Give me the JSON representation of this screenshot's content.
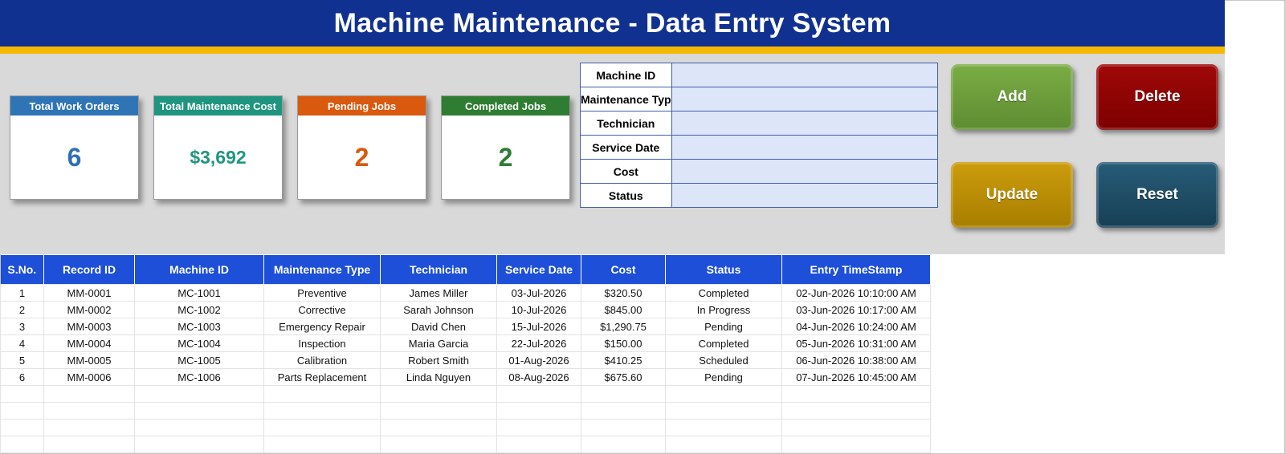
{
  "title": "Machine Maintenance - Data Entry System",
  "colors": {
    "title_bg": "#10318f",
    "stripe": "#f5b800",
    "header_bg": "#1d4fd8"
  },
  "kpis": [
    {
      "label": "Total Work Orders",
      "value": "6",
      "head_color": "#2f75b6",
      "value_color": "#2e6fb6"
    },
    {
      "label": "Total Maintenance Cost",
      "value": "$3,692",
      "head_color": "#1f9580",
      "value_color": "#1f9580"
    },
    {
      "label": "Pending Jobs",
      "value": "2",
      "head_color": "#d9590e",
      "value_color": "#d9590e"
    },
    {
      "label": "Completed Jobs",
      "value": "2",
      "head_color": "#2e7d32",
      "value_color": "#2e7d32"
    }
  ],
  "form": {
    "machine_id": {
      "label": "Machine ID",
      "value": ""
    },
    "maintenance_type": {
      "label": "Maintenance Typ",
      "value": ""
    },
    "technician": {
      "label": "Technician",
      "value": ""
    },
    "service_date": {
      "label": "Service Date",
      "value": ""
    },
    "cost": {
      "label": "Cost",
      "value": ""
    },
    "status": {
      "label": "Status",
      "value": ""
    }
  },
  "buttons": {
    "add": {
      "label": "Add",
      "color": "#6a9a3a"
    },
    "delete": {
      "label": "Delete",
      "color": "#8f0000"
    },
    "update": {
      "label": "Update",
      "color": "#bf9000"
    },
    "reset": {
      "label": "Reset",
      "color": "#1f4e68"
    }
  },
  "table": {
    "columns": [
      "S.No.",
      "Record ID",
      "Machine ID",
      "Maintenance Type",
      "Technician",
      "Service Date",
      "Cost",
      "Status",
      "Entry TimeStamp"
    ],
    "rows": [
      [
        "1",
        "MM-0001",
        "MC-1001",
        "Preventive",
        "James Miller",
        "03-Jul-2026",
        "$320.50",
        "Completed",
        "02-Jun-2026 10:10:00 AM"
      ],
      [
        "2",
        "MM-0002",
        "MC-1002",
        "Corrective",
        "Sarah Johnson",
        "10-Jul-2026",
        "$845.00",
        "In Progress",
        "03-Jun-2026 10:17:00 AM"
      ],
      [
        "3",
        "MM-0003",
        "MC-1003",
        "Emergency Repair",
        "David Chen",
        "15-Jul-2026",
        "$1,290.75",
        "Pending",
        "04-Jun-2026 10:24:00 AM"
      ],
      [
        "4",
        "MM-0004",
        "MC-1004",
        "Inspection",
        "Maria Garcia",
        "22-Jul-2026",
        "$150.00",
        "Completed",
        "05-Jun-2026 10:31:00 AM"
      ],
      [
        "5",
        "MM-0005",
        "MC-1005",
        "Calibration",
        "Robert Smith",
        "01-Aug-2026",
        "$410.25",
        "Scheduled",
        "06-Jun-2026 10:38:00 AM"
      ],
      [
        "6",
        "MM-0006",
        "MC-1006",
        "Parts Replacement",
        "Linda Nguyen",
        "08-Aug-2026",
        "$675.60",
        "Pending",
        "07-Jun-2026 10:45:00 AM"
      ]
    ]
  }
}
